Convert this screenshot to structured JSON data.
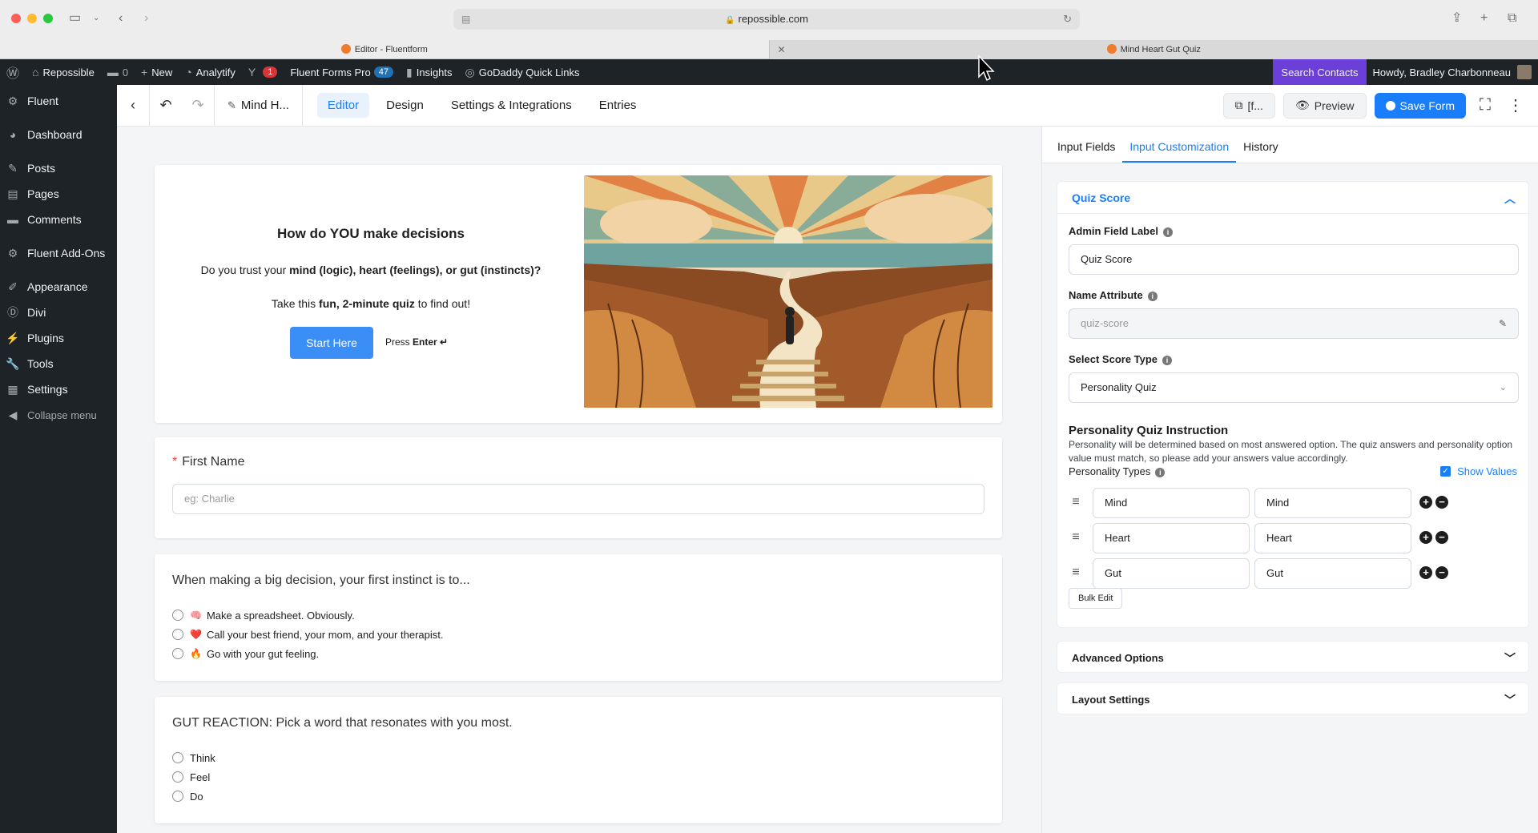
{
  "browser": {
    "url": "repossible.com",
    "tabs": [
      {
        "title": "Editor - Fluentform"
      },
      {
        "title": "Mind Heart Gut Quiz"
      }
    ]
  },
  "adminbar": {
    "site_name": "Repossible",
    "comments_count": "0",
    "new_label": "New",
    "analytify_label": "Analytify",
    "yoast_count": "1",
    "fluent_forms_label": "Fluent Forms Pro",
    "fluent_forms_count": "47",
    "insights_label": "Insights",
    "godaddy_label": "GoDaddy Quick Links",
    "search_contacts_label": "Search Contacts",
    "howdy_label": "Howdy, Bradley Charbonneau"
  },
  "sidebar": {
    "items": [
      {
        "label": "Fluent",
        "icon": "gear-icon"
      },
      {
        "label": "Dashboard",
        "icon": "dashboard-icon"
      },
      {
        "label": "Posts",
        "icon": "pin-icon"
      },
      {
        "label": "Pages",
        "icon": "pages-icon"
      },
      {
        "label": "Comments",
        "icon": "comment-icon"
      },
      {
        "label": "Fluent Add-Ons",
        "icon": "gear-icon"
      },
      {
        "label": "Appearance",
        "icon": "brush-icon"
      },
      {
        "label": "Divi",
        "icon": "divi-icon"
      },
      {
        "label": "Plugins",
        "icon": "plugin-icon"
      },
      {
        "label": "Tools",
        "icon": "wrench-icon"
      },
      {
        "label": "Settings",
        "icon": "settings-icon"
      }
    ],
    "collapse_label": "Collapse menu"
  },
  "toolbar": {
    "form_name": "Mind H...",
    "nav": [
      "Editor",
      "Design",
      "Settings & Integrations",
      "Entries"
    ],
    "shortcode_label": "[f...",
    "preview_label": "Preview",
    "save_label": "Save Form"
  },
  "form": {
    "intro": {
      "title": "How do YOU make decisions",
      "line1_prefix": "Do you trust your ",
      "line1_bold": "mind (logic), heart (feelings), or gut (instincts)?",
      "line2_prefix": "Take this ",
      "line2_bold": "fun, 2-minute quiz",
      "line2_suffix": " to find out!",
      "start_label": "Start Here",
      "press_label": "Press ",
      "enter_label": "Enter ↵"
    },
    "first_name": {
      "label": "First Name",
      "placeholder": "eg: Charlie"
    },
    "q1": {
      "title": "When making a big decision, your first instinct is to...",
      "options": [
        {
          "emoji": "🧠",
          "text": "Make a spreadsheet. Obviously."
        },
        {
          "emoji": "❤️",
          "text": "Call your best friend, your mom, and your therapist."
        },
        {
          "emoji": "🔥",
          "text": "Go with your gut feeling."
        }
      ]
    },
    "q2": {
      "title": "GUT REACTION: Pick a word that resonates with you most.",
      "options": [
        "Think",
        "Feel",
        "Do"
      ]
    }
  },
  "panel": {
    "tabs": [
      "Input Fields",
      "Input Customization",
      "History"
    ],
    "section_title": "Quiz Score",
    "admin_label": "Admin Field Label",
    "admin_value": "Quiz Score",
    "name_attr_label": "Name Attribute",
    "name_attr_value": "quiz-score",
    "score_type_label": "Select Score Type",
    "score_type_value": "Personality Quiz",
    "instruction_title": "Personality Quiz Instruction",
    "instruction_desc": "Personality will be determined based on most answered option. The quiz answers and personality option value must match, so please add your answers value accordingly.",
    "types_label": "Personality Types",
    "show_values_label": "Show Values",
    "types": [
      {
        "label": "Mind",
        "value": "Mind"
      },
      {
        "label": "Heart",
        "value": "Heart"
      },
      {
        "label": "Gut",
        "value": "Gut"
      }
    ],
    "bulk_edit_label": "Bulk Edit",
    "advanced_label": "Advanced Options",
    "layout_label": "Layout Settings"
  },
  "colors": {
    "accent": "#1a7efb",
    "admin_bar": "#1d2327",
    "search_contacts": "#6c3fd8"
  }
}
